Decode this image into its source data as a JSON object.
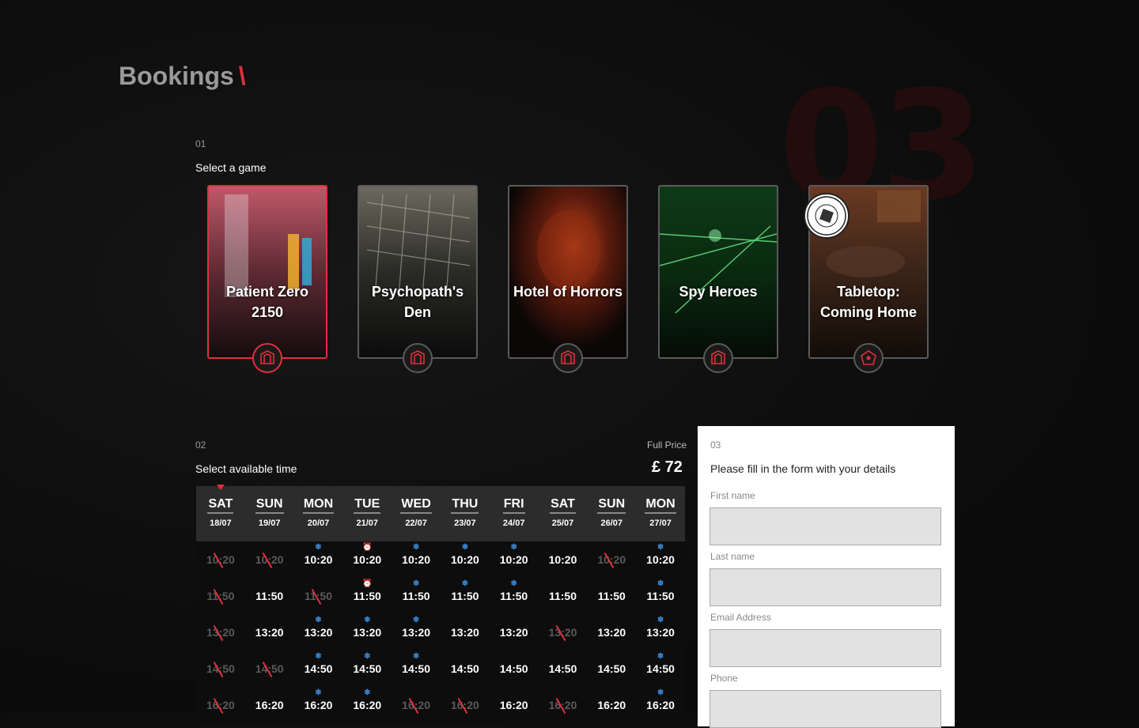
{
  "header": {
    "title": "Bookings",
    "slash": "\\",
    "bg_step": "03"
  },
  "step1": {
    "num": "01",
    "label": "Select a game"
  },
  "games": [
    {
      "title": "Patient Zero 2150",
      "selected": true
    },
    {
      "title": "Psychopath's Den",
      "selected": false
    },
    {
      "title": "Hotel of Horrors",
      "selected": false
    },
    {
      "title": "Spy Heroes",
      "selected": false
    },
    {
      "title": "Tabletop: Coming Home",
      "selected": false
    }
  ],
  "step2": {
    "num": "02",
    "label": "Select available time"
  },
  "price": {
    "label": "Full Price",
    "value": "£ 72"
  },
  "days": [
    {
      "name": "SAT",
      "date": "18/07"
    },
    {
      "name": "SUN",
      "date": "19/07"
    },
    {
      "name": "MON",
      "date": "20/07"
    },
    {
      "name": "TUE",
      "date": "21/07"
    },
    {
      "name": "WED",
      "date": "22/07"
    },
    {
      "name": "THU",
      "date": "23/07"
    },
    {
      "name": "FRI",
      "date": "24/07"
    },
    {
      "name": "SAT",
      "date": "25/07"
    },
    {
      "name": "SUN",
      "date": "26/07"
    },
    {
      "name": "MON",
      "date": "27/07"
    }
  ],
  "slots": [
    [
      {
        "t": "10:20",
        "s": "na"
      },
      {
        "t": "10:20",
        "s": "na"
      },
      {
        "t": "10:20",
        "s": "ok",
        "i": "snow"
      },
      {
        "t": "10:20",
        "s": "ok",
        "i": "clock"
      },
      {
        "t": "10:20",
        "s": "ok",
        "i": "snow"
      },
      {
        "t": "10:20",
        "s": "ok",
        "i": "snow"
      },
      {
        "t": "10:20",
        "s": "ok",
        "i": "snow"
      },
      {
        "t": "10:20",
        "s": "ok"
      },
      {
        "t": "10:20",
        "s": "na"
      },
      {
        "t": "10:20",
        "s": "ok",
        "i": "snow"
      }
    ],
    [
      {
        "t": "11:50",
        "s": "na"
      },
      {
        "t": "11:50",
        "s": "ok"
      },
      {
        "t": "11:50",
        "s": "na"
      },
      {
        "t": "11:50",
        "s": "ok",
        "i": "clock"
      },
      {
        "t": "11:50",
        "s": "ok",
        "i": "snow"
      },
      {
        "t": "11:50",
        "s": "ok",
        "i": "snow"
      },
      {
        "t": "11:50",
        "s": "ok",
        "i": "snow"
      },
      {
        "t": "11:50",
        "s": "ok"
      },
      {
        "t": "11:50",
        "s": "ok"
      },
      {
        "t": "11:50",
        "s": "ok",
        "i": "snow"
      }
    ],
    [
      {
        "t": "13:20",
        "s": "na"
      },
      {
        "t": "13:20",
        "s": "ok"
      },
      {
        "t": "13:20",
        "s": "ok",
        "i": "snow"
      },
      {
        "t": "13:20",
        "s": "ok",
        "i": "snow"
      },
      {
        "t": "13:20",
        "s": "ok",
        "i": "snow"
      },
      {
        "t": "13:20",
        "s": "ok"
      },
      {
        "t": "13:20",
        "s": "ok"
      },
      {
        "t": "13:20",
        "s": "na"
      },
      {
        "t": "13:20",
        "s": "ok"
      },
      {
        "t": "13:20",
        "s": "ok",
        "i": "snow"
      }
    ],
    [
      {
        "t": "14:50",
        "s": "na"
      },
      {
        "t": "14:50",
        "s": "na"
      },
      {
        "t": "14:50",
        "s": "ok",
        "i": "snow"
      },
      {
        "t": "14:50",
        "s": "ok",
        "i": "snow"
      },
      {
        "t": "14:50",
        "s": "ok",
        "i": "snow"
      },
      {
        "t": "14:50",
        "s": "ok"
      },
      {
        "t": "14:50",
        "s": "ok"
      },
      {
        "t": "14:50",
        "s": "ok"
      },
      {
        "t": "14:50",
        "s": "ok"
      },
      {
        "t": "14:50",
        "s": "ok",
        "i": "snow"
      }
    ],
    [
      {
        "t": "16:20",
        "s": "na"
      },
      {
        "t": "16:20",
        "s": "ok"
      },
      {
        "t": "16:20",
        "s": "ok",
        "i": "snow"
      },
      {
        "t": "16:20",
        "s": "ok",
        "i": "snow"
      },
      {
        "t": "16:20",
        "s": "na"
      },
      {
        "t": "16:20",
        "s": "na"
      },
      {
        "t": "16:20",
        "s": "ok"
      },
      {
        "t": "16:20",
        "s": "na"
      },
      {
        "t": "16:20",
        "s": "ok"
      },
      {
        "t": "16:20",
        "s": "ok",
        "i": "snow"
      }
    ]
  ],
  "step3": {
    "num": "03",
    "label": "Please fill in the form with your details"
  },
  "form": {
    "first_name": "First name",
    "last_name": "Last name",
    "email": "Email Address",
    "phone": "Phone"
  },
  "colors": {
    "accent": "#e0313c",
    "snow_icon": "#3a8fe0"
  }
}
